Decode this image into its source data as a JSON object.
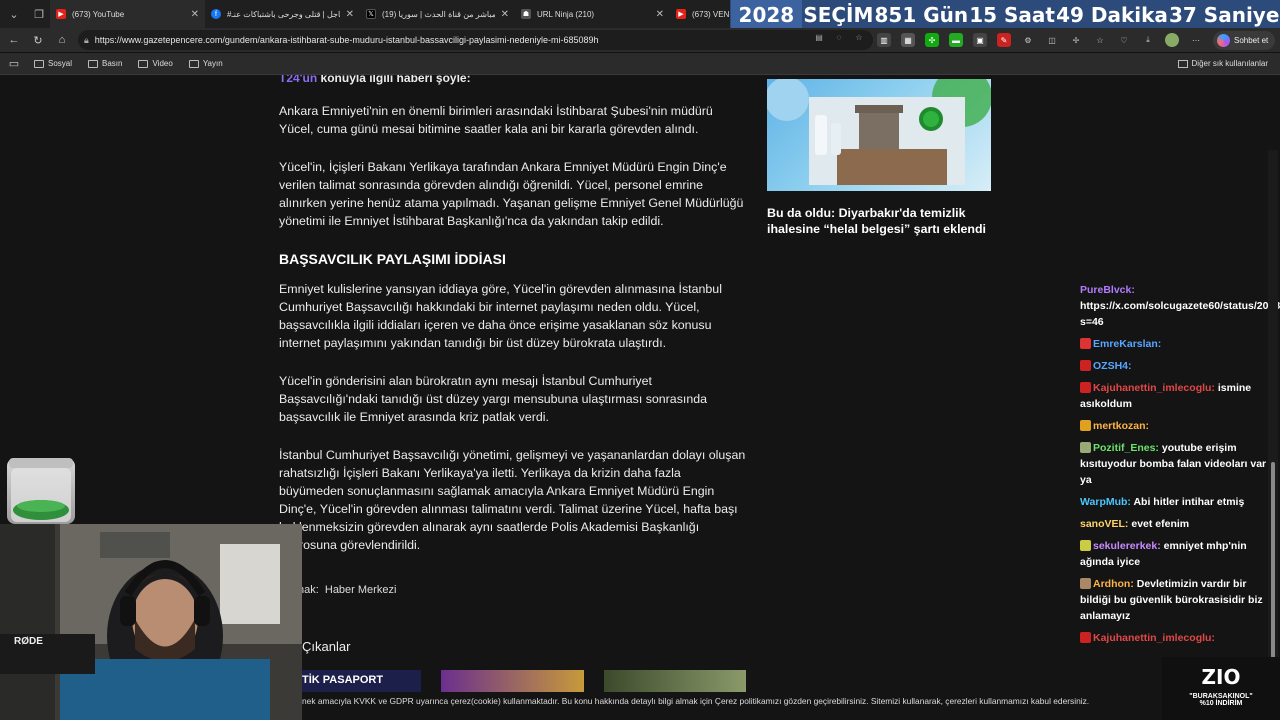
{
  "tabs": [
    {
      "title": "(673) YouTube",
      "icon": "youtube-icon"
    },
    {
      "title": "#عاجل | قتلى وجرحى باشتباكات عنـ",
      "icon": "facebook-icon"
    },
    {
      "title": "(19) مباشر من قناة الحدث | سوريا...",
      "icon": "x-icon"
    },
    {
      "title": "URL Ninja (210)",
      "icon": "ninja-icon"
    },
    {
      "title": "(673) VENE",
      "icon": "youtube-icon"
    }
  ],
  "countdown": {
    "year": "2028",
    "label": "SEÇİM",
    "days": "851 Gün",
    "hours": "15 Saat",
    "minutes": "49 Dakika",
    "seconds": "37 Saniye"
  },
  "address": {
    "url": "https://www.gazetepencere.com/gundem/ankara-istihbarat-sube-muduru-istanbul-bassavciligi-paylasimi-nedeniyle-mi-685089h"
  },
  "profile": {
    "label": "Sohbet et"
  },
  "bookmarks": {
    "items": [
      "Sosyal",
      "Basın",
      "Video",
      "Yayın"
    ],
    "other": "Diğer sık kullanılanlar"
  },
  "article": {
    "lead_prefix": "T24'ün",
    "lead_rest": "konuyla ilgili haberi şöyle:",
    "paragraphs": [
      "Ankara Emniyeti'nin en önemli birimleri arasındaki İstihbarat Şubesi'nin müdürü Yücel, cuma günü mesai bitimine saatler kala ani bir kararla görevden alındı.",
      "Yücel'in, İçişleri Bakanı Yerlikaya tarafından Ankara Emniyet Müdürü Engin Dinç'e verilen talimat sonrasında görevden alındığı öğrenildi. Yücel, personel emrine alınırken yerine henüz atama yapılmadı. Yaşanan gelişme Emniyet Genel Müdürlüğü yönetimi ile Emniyet İstihbarat Başkanlığı'nca da yakından takip edildi."
    ],
    "heading": "BAŞSAVCILIK PAYLAŞIMI İDDİASI",
    "paragraphs2": [
      "Emniyet kulislerine yansıyan iddiaya göre, Yücel'in görevden alınmasına İstanbul Cumhuriyet Başsavcılığı hakkındaki bir internet paylaşımı neden oldu. Yücel, başsavcılıkla ilgili iddiaları içeren ve daha önce erişime yasaklanan söz konusu internet paylaşımını yakından tanıdığı bir üst düzey bürokrata ulaştırdı.",
      "Yücel'in gönderisini alan bürokratın aynı mesajı İstanbul Cumhuriyet Başsavcılığı'ndaki tanıdığı üst düzey yargı mensubuna ulaştırması sonrasında başsavcılık ile Emniyet arasında kriz patlak verdi.",
      "İstanbul Cumhuriyet Başsavcılığı yönetimi, gelişmeyi ve yaşananlardan dolayı oluşan rahatsızlığı İçişleri Bakanı Yerlikaya'ya iletti. Yerlikaya da krizin daha fazla büyümeden sonuçlanmasını sağlamak amacıyla Ankara Emniyet Müdürü Engin Dinç'e, Yücel'in görevden alınması talimatını verdi. Talimat üzerine Yücel, hafta başı beklenmeksizin görevden alınarak aynı saatlerde Polis Akademisi Başkanlığı kadrosuna görevlendirildi."
    ],
    "source_label": "Kaynak:",
    "source_value": "Haber Merkezi",
    "related_title": "Çıkanlar",
    "thumb1_text": "TİK PASAPORT"
  },
  "sidebar": {
    "card_title": "Bu da oldu: Diyarbakır'da temizlik ihalesine “helal belgesi” şartı eklendi"
  },
  "chat": [
    {
      "user": "PureBlvck:",
      "text": "https://x.com/solcugazete60/status/2008522226899824688?s=46",
      "color": "#b27cff",
      "badge": ""
    },
    {
      "user": "EmreKarslan:",
      "text": "",
      "color": "#58a6ff",
      "badge": "#d33"
    },
    {
      "user": "OZSH4:",
      "text": "",
      "color": "#58a6ff",
      "badge": "#c22"
    },
    {
      "user": "Kajuhanettin_imlecoglu:",
      "text": "isminе asıkoldum",
      "color": "#e04848",
      "badge": "#c22"
    },
    {
      "user": "mertkozan:",
      "text": "",
      "color": "#ffb347",
      "badge": "#e0a020"
    },
    {
      "user": "Pozitif_Enes:",
      "text": "youtube erişim kısıtuyodur bomba falan videoları var ya",
      "color": "#6be36b",
      "badge": "#9a7"
    },
    {
      "user": "WarpMub:",
      "text": "Abi hitler intihar etmiş",
      "color": "#4cc6ff",
      "badge": ""
    },
    {
      "user": "sanoVEL:",
      "text": "evet efenim",
      "color": "#ffd36b",
      "badge": ""
    },
    {
      "user": "sekulererkek:",
      "text": "emniyet mhp'nin ağında iyice",
      "color": "#c98cff",
      "badge": "#cc4"
    },
    {
      "user": "Ardhon:",
      "text": "Devletimizin vardır bir bildiği bu güvenlik bürokrasisidir biz anlamayız",
      "color": "#ffb347",
      "badge": "#a86"
    },
    {
      "user": "Kajuhanettin_imlecoglu:",
      "text": "",
      "color": "#e04848",
      "badge": "#c22"
    }
  ],
  "cookie": {
    "text": "nek amacıyla KVKK ve GDPR uyarınca çerez(cookie) kullanmaktadır. Bu konu hakkında detaylı bilgi almak için Çerez politikamızı gözden geçirebilirsiniz. Sitemizi kullanarak, çerezleri kullanmamızı kabul edersiniz."
  },
  "promo": {
    "logo": "ZIO",
    "line1": "\"BURAKSAKINOL\"",
    "line2": "%10 İNDİRİM"
  },
  "webcam": {
    "mic_label": "RØDE"
  },
  "colors": {
    "countdown_bg": "#2c4a7a",
    "link_purple": "#8a6df0"
  }
}
